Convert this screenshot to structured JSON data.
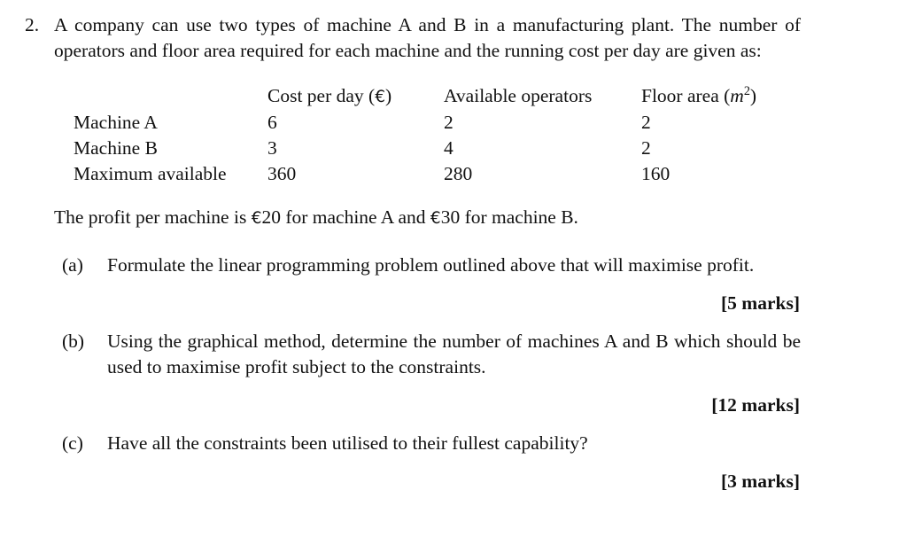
{
  "question": {
    "number": "2.",
    "intro": "A company can use two types of machine A and B in a manufacturing plant. The number of operators and floor area required for each machine and the running cost per day are given as:",
    "profit_statement_pre": "The profit per machine is ",
    "profit_currency_a": "€",
    "profit_amount_a": "20 for machine A and ",
    "profit_currency_b": "€",
    "profit_amount_b": "30 for machine B."
  },
  "table": {
    "headers": {
      "label_col": "",
      "cost_pre": "Cost per day (",
      "cost_currency": "€",
      "cost_post": ")",
      "operators": "Available operators",
      "floor_pre": "Floor area (",
      "floor_var": "m",
      "floor_sup": "2",
      "floor_post": ")"
    },
    "rows": [
      {
        "label": "Machine A",
        "cost": "6",
        "operators": "2",
        "floor": "2"
      },
      {
        "label": "Machine B",
        "cost": "3",
        "operators": "4",
        "floor": "2"
      },
      {
        "label": "Maximum available",
        "cost": "360",
        "operators": "280",
        "floor": "160"
      }
    ]
  },
  "parts": [
    {
      "label": "(a)",
      "text": "Formulate the linear programming problem outlined above that will maximise profit.",
      "marks": "[5 marks]"
    },
    {
      "label": "(b)",
      "text": "Using the graphical method, determine the number of machines A and B which should be used to maximise profit subject to the constraints.",
      "marks": "[12 marks]"
    },
    {
      "label": "(c)",
      "text": "Have all the constraints been utilised to their fullest capability?",
      "marks": "[3 marks]"
    }
  ]
}
